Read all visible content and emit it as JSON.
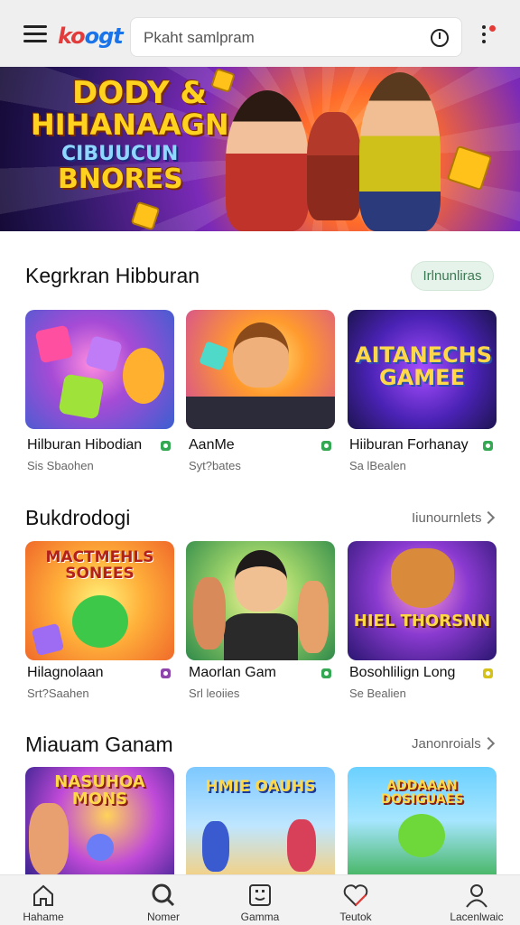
{
  "header": {
    "logo": {
      "part1": "ko",
      "part2": "ogt",
      "display": "koogt"
    },
    "search_placeholder": "Pkaht samlpram",
    "icons": {
      "menu": "hamburger-icon",
      "history": "clock-icon",
      "more": "kebab-icon"
    }
  },
  "banner": {
    "line1": "DODY &",
    "line2": "HIHANAAGN",
    "line3": "CIBUUCUN",
    "line4": "BNORES"
  },
  "sections": [
    {
      "title": "Kegrkran Hibburan",
      "action": "Irlnunliras",
      "games": [
        {
          "name": "Hilburan Hibodian",
          "sub": "Sis Sbaohen",
          "tag_color": "#34a853"
        },
        {
          "name": "AanMe",
          "sub": "Syt?bates",
          "tag_color": "#34a853"
        },
        {
          "name": "Hiiburan Forhanay",
          "sub": "Sa lBealen",
          "tag_color": "#34a853"
        }
      ],
      "card_texts": [
        "",
        "",
        "AITANECHS GAMEE"
      ]
    },
    {
      "title": "Bukdrodogi",
      "action": "Iiunournlets",
      "games": [
        {
          "name": "Hilagnolaan",
          "sub": "Srt?Saahen",
          "tag_color": "#8e44ad"
        },
        {
          "name": "Maorlan Gam",
          "sub": "Srl leoiies",
          "tag_color": "#34a853"
        },
        {
          "name": "Bosohlilign Long",
          "sub": "Se Bealien",
          "tag_color": "#d4c21a"
        }
      ],
      "card_texts": [
        "MACTMEHLS SONEES",
        "",
        "HIEL THORSNN"
      ]
    },
    {
      "title": "Miauam Ganam",
      "action": "Janonroials",
      "games": [],
      "card_texts": [
        "NASUHOA MONS",
        "HMIE OAUHS",
        "ADDAAAN DOSIGUAES"
      ]
    }
  ],
  "bottom_nav": [
    {
      "label": "Hahame",
      "icon": "home-icon"
    },
    {
      "label": "Nomer",
      "icon": "search-icon"
    },
    {
      "label": "Gamma",
      "icon": "game-icon"
    },
    {
      "label": "Teutok",
      "icon": "heart-icon"
    },
    {
      "label": "Lacenlwaic",
      "icon": "profile-icon"
    }
  ]
}
